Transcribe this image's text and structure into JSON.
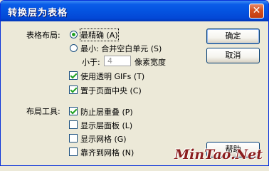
{
  "window": {
    "title": "转换层为表格"
  },
  "title_bar": {
    "close_icon": "close-icon",
    "close_glyph": "✕"
  },
  "table_layout": {
    "label": "表格布局:",
    "most_accurate": {
      "label": "最精确 (A)",
      "selected": true
    },
    "smallest": {
      "label": "最小: 合并空白单元 (S)",
      "selected": false
    },
    "less_than_label": "小于:",
    "less_than_value": "4",
    "pixels_width_label": "像素宽度",
    "use_transparent_gifs": {
      "label": "使用透明 GIFs (T)",
      "checked": true
    },
    "center_on_page": {
      "label": "置于页面中央 (C)",
      "checked": true
    }
  },
  "layout_tools": {
    "label": "布局工具:",
    "prevent_overlap": {
      "label": "防止层重叠 (P)",
      "checked": true
    },
    "show_layer_panel": {
      "label": "显示层面板 (L)",
      "checked": false
    },
    "show_grid": {
      "label": "显示网格 (G)",
      "checked": false
    },
    "snap_to_grid": {
      "label": "靠齐到网格 (N)",
      "checked": false
    }
  },
  "buttons": {
    "ok": "确定",
    "cancel": "取消",
    "help": "帮助"
  },
  "watermark": "MinTao.Net"
}
